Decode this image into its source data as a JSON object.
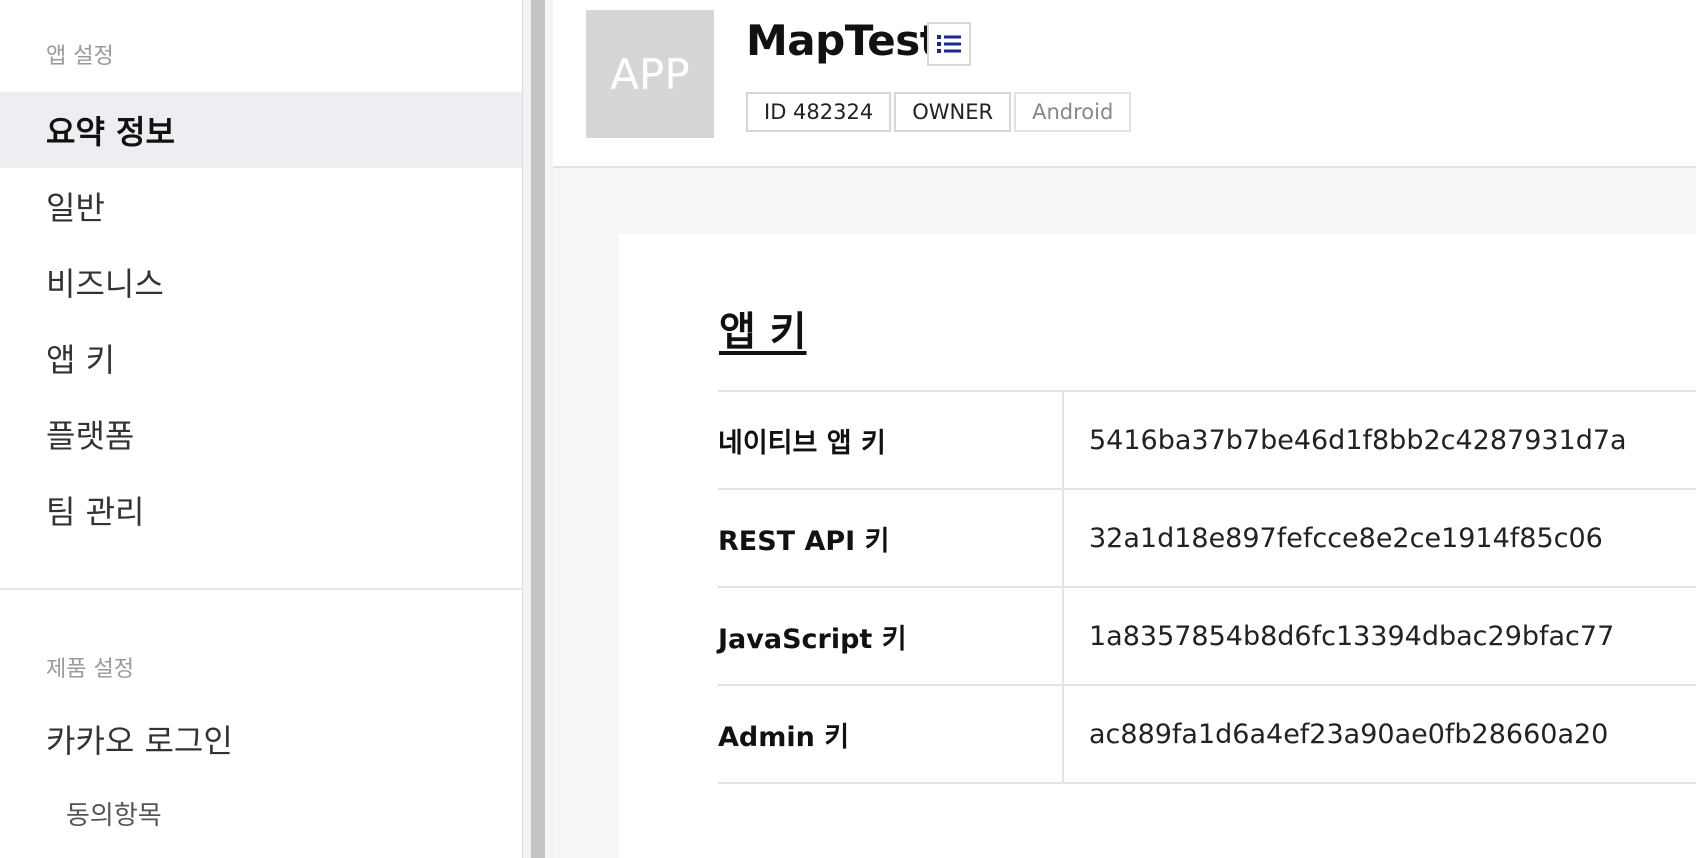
{
  "sidebar": {
    "app_settings_title": "앱 설정",
    "items": [
      {
        "label": "요약 정보",
        "active": true
      },
      {
        "label": "일반"
      },
      {
        "label": "비즈니스"
      },
      {
        "label": "앱 키"
      },
      {
        "label": "플랫폼"
      },
      {
        "label": "팀 관리"
      }
    ],
    "product_settings_title": "제품 설정",
    "product_items": [
      {
        "label": "카카오 로그인"
      }
    ],
    "sub_items": [
      {
        "label": "동의항목"
      }
    ]
  },
  "header": {
    "logo_text": "APP",
    "app_name": "MapTest",
    "list_icon": "list-icon",
    "badges": {
      "id": "ID 482324",
      "role": "OWNER",
      "platform": "Android"
    }
  },
  "app_keys": {
    "title": "앱 키",
    "rows": [
      {
        "label": "네이티브 앱 키",
        "value": "5416ba37b7be46d1f8bb2c4287931d7a"
      },
      {
        "label": "REST API 키",
        "value": "32a1d18e897fefcce8e2ce1914f85c06"
      },
      {
        "label": "JavaScript 키",
        "value": "1a8357854b8d6fc13394dbac29bfac77"
      },
      {
        "label": "Admin 키",
        "value": "ac889fa1d6a4ef23a90ae0fb28660a20"
      }
    ]
  },
  "colors": {
    "active_bg": "#eceef2",
    "list_icon": "#1a2a8c"
  }
}
